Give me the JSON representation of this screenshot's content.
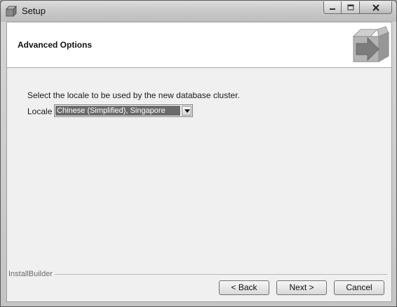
{
  "window": {
    "title": "Setup"
  },
  "caption_buttons": {
    "minimize_icon": "minimize-icon",
    "maximize_icon": "maximize-icon",
    "close_icon": "close-icon"
  },
  "header": {
    "title": "Advanced Options",
    "icon": "installer-box-arrow-icon"
  },
  "content": {
    "instruction": "Select the locale to be used by the new database cluster.",
    "locale_label": "Locale",
    "locale_value": "Chinese (Simplified), Singapore"
  },
  "footer": {
    "brand": "InstallBuilder",
    "back_label": "< Back",
    "next_label": "Next >",
    "cancel_label": "Cancel"
  }
}
